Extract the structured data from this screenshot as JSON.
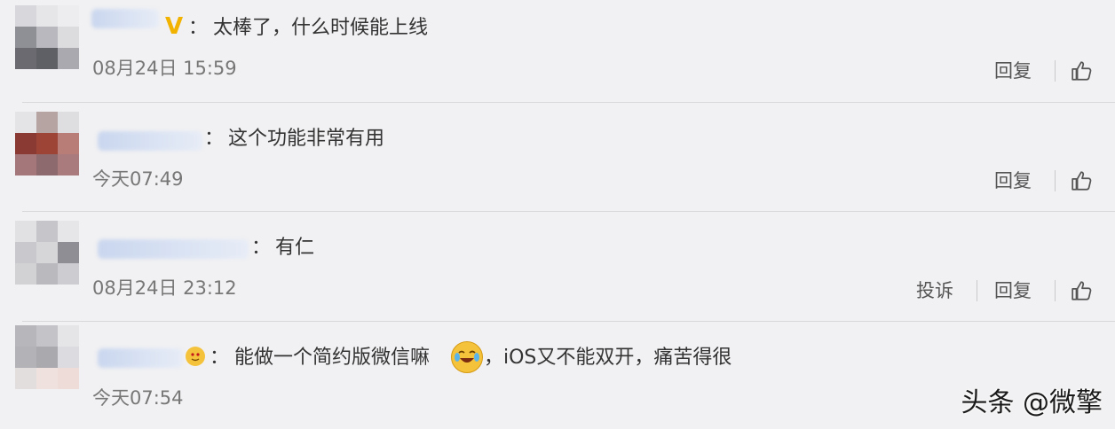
{
  "comments": [
    {
      "text": "太棒了，什么时候能上线",
      "time": "08月24日 15:59",
      "reply_label": "回复",
      "badge": "V",
      "colon": "："
    },
    {
      "text": "这个功能非常有用",
      "time": "今天07:49",
      "reply_label": "回复",
      "colon": "："
    },
    {
      "text": "有仁",
      "time": "08月24日 23:12",
      "report_label": "投诉",
      "reply_label": "回复",
      "colon": "："
    },
    {
      "text_before_emoji": "能做一个简约版微信嘛",
      "text_after_emoji": "，iOS又不能双开，痛苦得很",
      "time": "今天07:54",
      "colon": "："
    }
  ],
  "icons": {
    "like": "thumbs-up-icon",
    "emoji": "laughing-crying-emoji-icon",
    "badge": "emoji-badge-icon"
  },
  "watermark": "头条 @微擎",
  "colors": {
    "badge": "#f2b200",
    "background": "#f1f1f3"
  }
}
